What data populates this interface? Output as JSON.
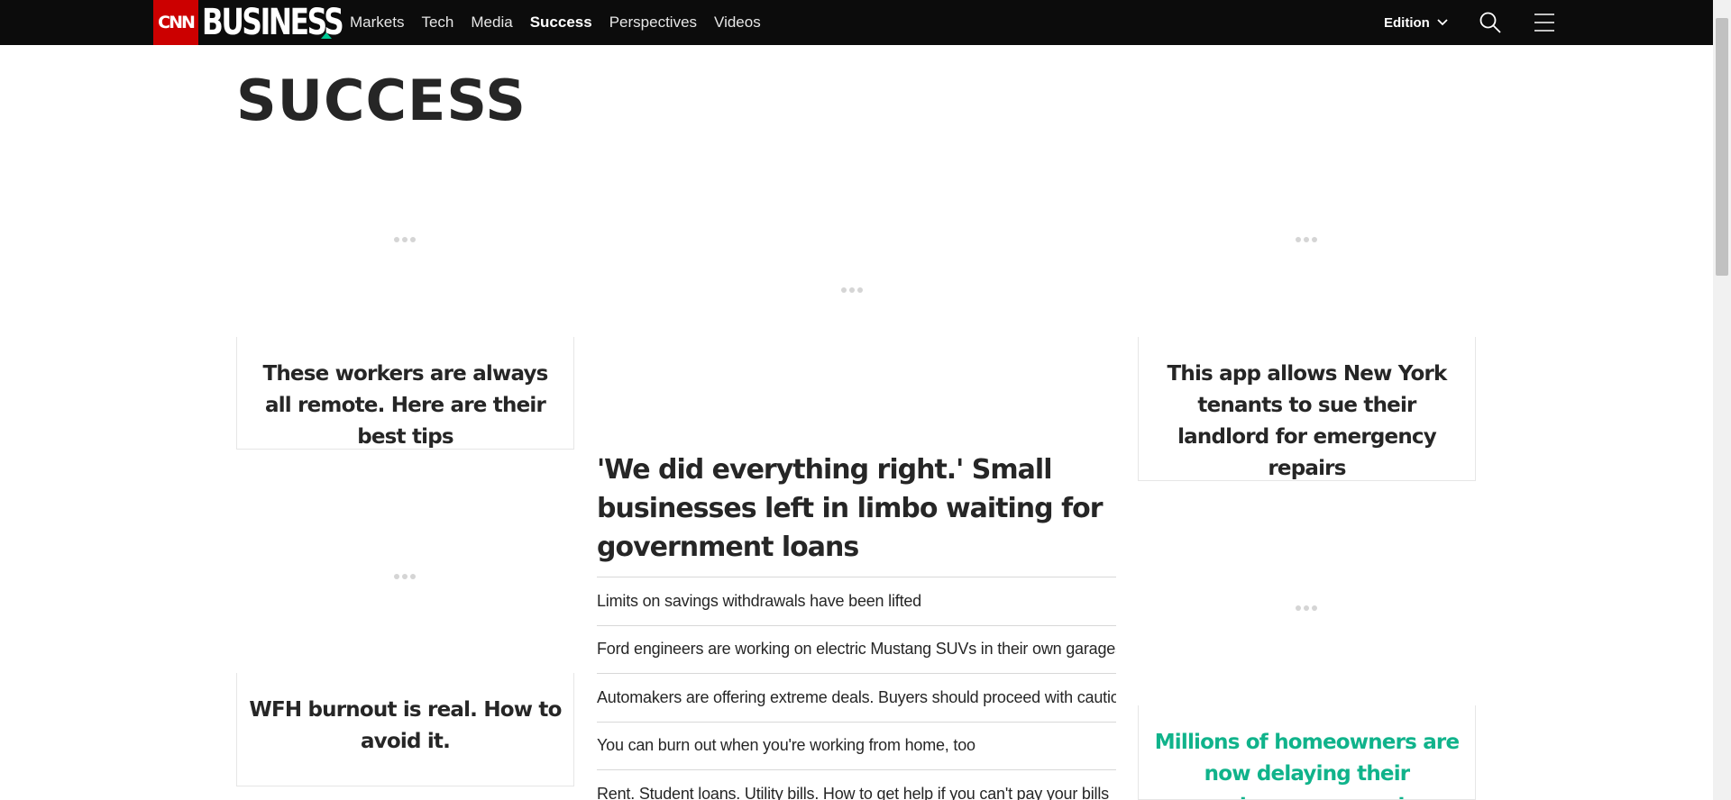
{
  "brand": {
    "cnn_label": "CNN",
    "business_label": "BUSINESS"
  },
  "nav": {
    "items": [
      {
        "label": "Markets"
      },
      {
        "label": "Tech"
      },
      {
        "label": "Media"
      },
      {
        "label": "Success",
        "active": true
      },
      {
        "label": "Perspectives"
      },
      {
        "label": "Videos"
      }
    ],
    "edition_label": "Edition",
    "icons": {
      "search": "search-icon",
      "menu": "hamburger-menu-icon",
      "edition": "chevron-down-icon"
    }
  },
  "colors": {
    "brand_red": "#cc0000",
    "accent_green": "#00c995",
    "link_green": "#10b38b",
    "topbar": "#0c0c0c"
  },
  "page": {
    "title": "SUCCESS"
  },
  "cards": {
    "remote_workers": "These workers are always all remote. Here are their best tips",
    "ny_tenants": "This app allows New York tenants to sue their landlord for emergency repairs",
    "wfh_burnout": "WFH burnout is real. How to avoid it.",
    "homeowners": "Millions of homeowners are now delaying their mortgage payments"
  },
  "main_story": {
    "headline": "'We did everything right.' Small businesses left in limbo waiting for government loans",
    "links": [
      "Limits on savings withdrawals have been lifted",
      "Ford engineers are working on electric Mustang SUVs in their own garages",
      "Automakers are offering extreme deals. Buyers should proceed with caution",
      "You can burn out when you're working from home, too",
      "Rent. Student loans. Utility bills. How to get help if you can't pay your bills"
    ]
  }
}
